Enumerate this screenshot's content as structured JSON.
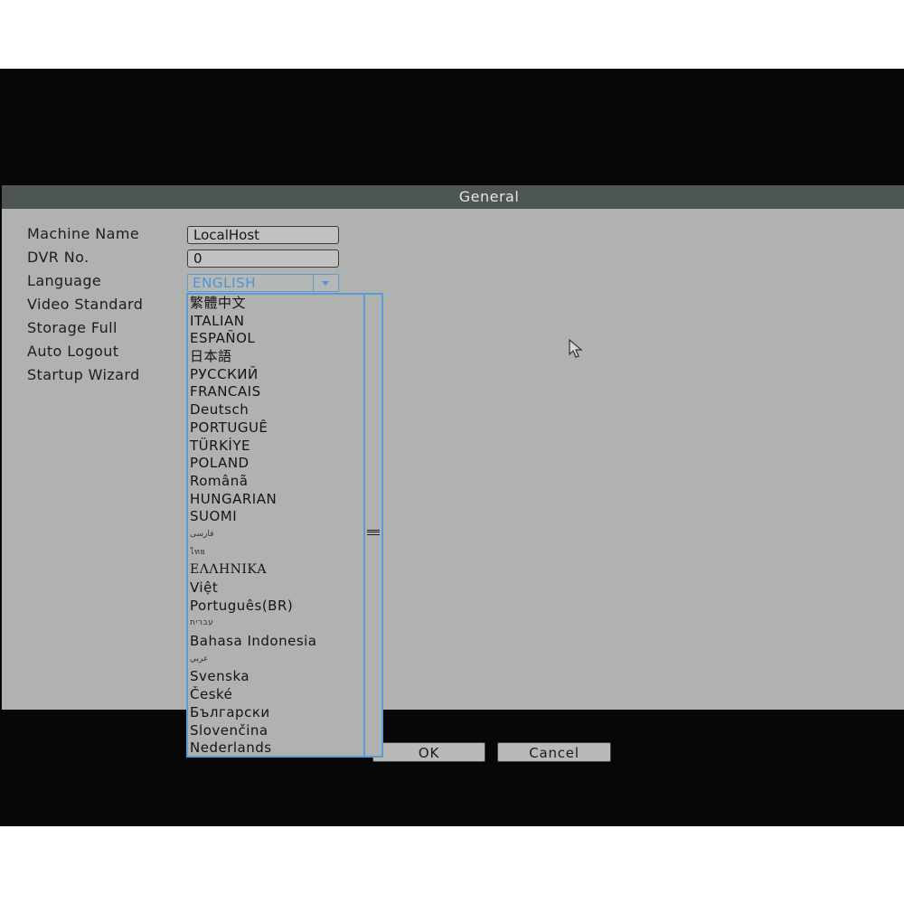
{
  "dialog": {
    "title": "General",
    "fields": {
      "machine_name_label": "Machine Name",
      "machine_name_value": "LocalHost",
      "dvr_no_label": "DVR No.",
      "dvr_no_value": "0",
      "language_label": "Language",
      "language_value": "ENGLISH",
      "video_standard_label": "Video Standard",
      "storage_full_label": "Storage Full",
      "auto_logout_label": "Auto Logout",
      "startup_wizard_label": "Startup Wizard"
    },
    "buttons": {
      "ok": "OK",
      "cancel": "Cancel"
    }
  },
  "language_dropdown": {
    "options": [
      "繁體中文",
      "ITALIAN",
      "ESPAÑOL",
      "日本語",
      "РУССКИЙ",
      "FRANCAIS",
      "Deutsch",
      "PORTUGUÊ",
      "TÜRKİYE",
      "POLAND",
      "Românã",
      "HUNGARIAN",
      "SUOMI",
      "فارسی",
      "ไทย",
      "ΕΛΛΗΝΙΚΑ",
      "Việt",
      "Português(BR)",
      "עברית",
      "Bahasa Indonesia",
      "عربي",
      "Svenska",
      "České",
      "Български",
      "Slovenčina",
      "Nederlands"
    ]
  },
  "icons": {
    "cursor": "mouse-pointer-icon",
    "arrow": "chevron-down-icon",
    "scroll": "scroll-grip-icon"
  },
  "colors": {
    "accent": "#5b9bd6",
    "title_bar": "#4d5555",
    "panel": "#b0b2af"
  }
}
